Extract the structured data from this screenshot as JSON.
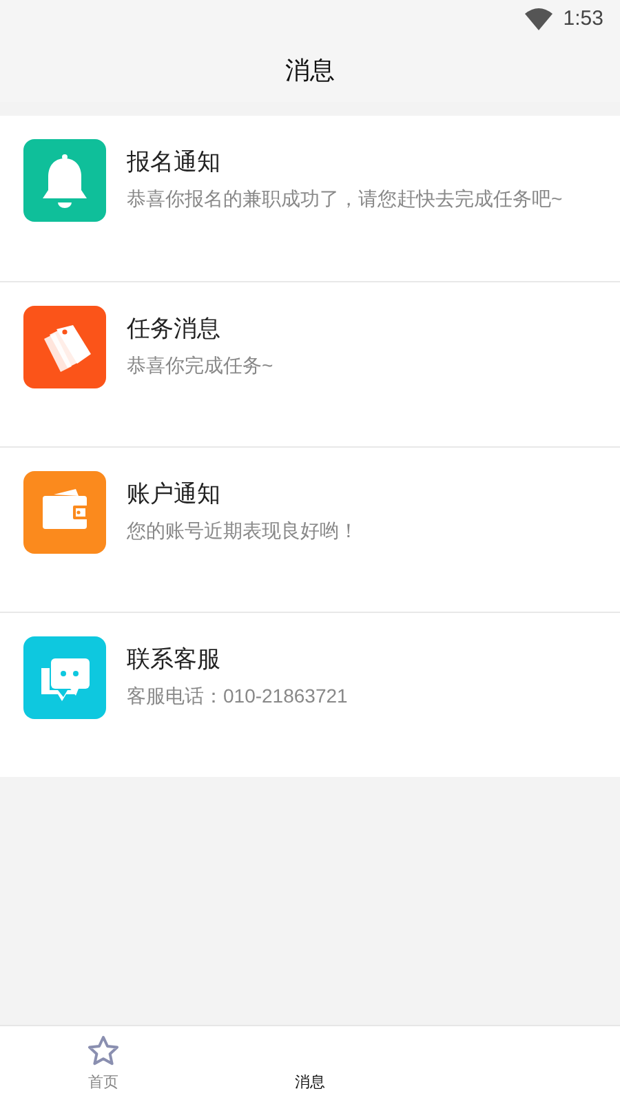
{
  "status_bar": {
    "time": "1:53"
  },
  "header": {
    "title": "消息"
  },
  "messages": [
    {
      "kind": "bell",
      "color": "#0fbf9a",
      "title": "报名通知",
      "text": "恭喜你报名的兼职成功了，请您赶快去完成任务吧~"
    },
    {
      "kind": "tags",
      "color": "#fb5419",
      "title": "任务消息",
      "text": "恭喜你完成任务~"
    },
    {
      "kind": "wallet",
      "color": "#fb8a1d",
      "title": "账户通知",
      "text": "您的账号近期表现良好哟！"
    },
    {
      "kind": "chat",
      "color": "#0ec8df",
      "title": "联系客服",
      "text": "客服电话：010-21863721"
    }
  ],
  "tabs": [
    {
      "label": "首页",
      "selected": false
    },
    {
      "label": "消息",
      "selected": true
    }
  ]
}
